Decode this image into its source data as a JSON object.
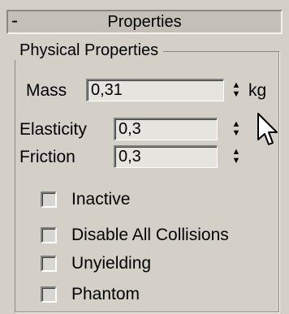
{
  "rollout": {
    "toggle": "-",
    "title": "Properties"
  },
  "group": {
    "title": "Physical Properties"
  },
  "fields": {
    "mass": {
      "label": "Mass",
      "value": "0,31",
      "unit": "kg"
    },
    "elasticity": {
      "label": "Elasticity",
      "value": "0,3"
    },
    "friction": {
      "label": "Friction",
      "value": "0,3"
    }
  },
  "checkboxes": [
    {
      "label": "Inactive",
      "checked": false
    },
    {
      "label": "Disable All Collisions",
      "checked": false
    },
    {
      "label": "Unyielding",
      "checked": false
    },
    {
      "label": "Phantom",
      "checked": false
    }
  ],
  "icons": {
    "spinner": "spinner-arrows-icon",
    "cursor": "mouse-pointer-icon"
  },
  "colors": {
    "panel": "#d4d0c8",
    "field": "#e6e4df"
  }
}
